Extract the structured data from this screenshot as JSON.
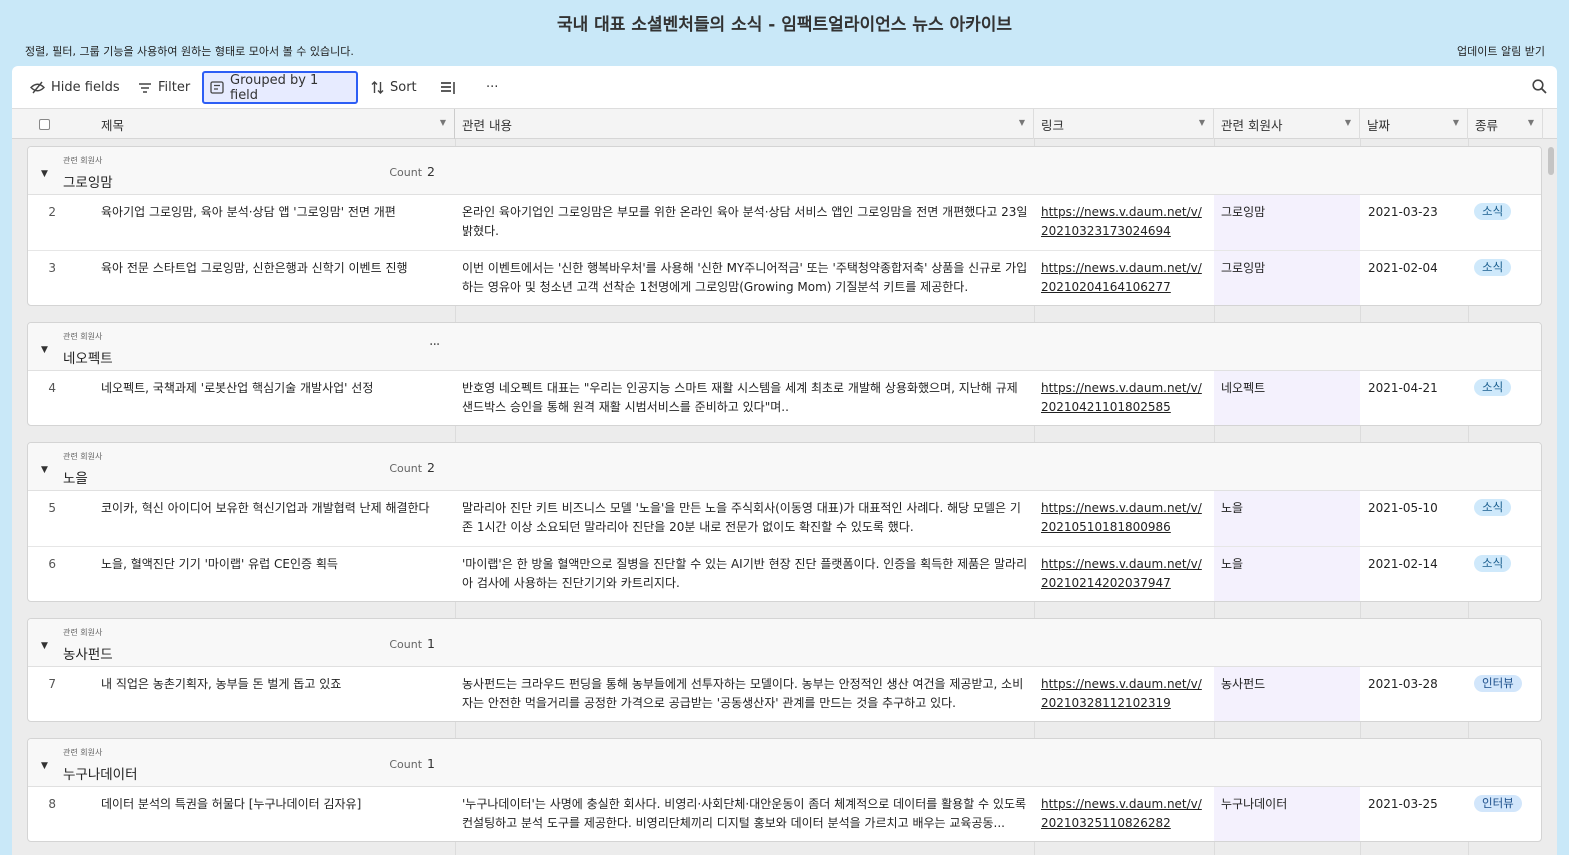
{
  "page": {
    "title": "국내 대표 소셜벤처들의 소식 - 임팩트얼라이언스 뉴스 아카이브",
    "subtitle": "정렬, 필터, 그룹 기능을 사용하여 원하는 형태로 모아서 볼 수 있습니다.",
    "subscribe": "업데이트 알림 받기"
  },
  "toolbar": {
    "hide_fields": "Hide fields",
    "filter": "Filter",
    "grouped": "Grouped by 1 field",
    "sort": "Sort",
    "more": "···"
  },
  "columns": {
    "title": "제목",
    "content": "관련 내용",
    "link": "링크",
    "member": "관련 회원사",
    "date": "날짜",
    "type": "종류"
  },
  "groups": [
    {
      "field": "관련 회원사",
      "name": "그로잉맘",
      "count_label": "Count",
      "count": "2",
      "rows": [
        {
          "num": "2",
          "title": "육아기업 그로잉맘, 육아 분석·상담 앱 '그로잉맘' 전면 개편",
          "content": "온라인 육아기업인 그로잉맘은 부모를 위한 온라인 육아 분석·상담 서비스 앱인 그로잉맘을 전면 개편했다고 23일 밝혔다.",
          "link": "https://news.v.daum.net/v/20210323173024694",
          "member": "그로잉맘",
          "date": "2021-03-23",
          "type": "소식"
        },
        {
          "num": "3",
          "title": "육아 전문 스타트업 그로잉맘, 신한은행과 신학기 이벤트 진행",
          "content": "이번 이벤트에서는 '신한 행복바우처'를 사용해 '신한 MY주니어적금' 또는 '주택청약종합저축' 상품을 신규로 가입하는 영유아 및 청소년 고객 선착순 1천명에게 그로잉맘(Growing Mom) 기질분석 키트를 제공한다.",
          "link": "https://news.v.daum.net/v/20210204164106277",
          "member": "그로잉맘",
          "date": "2021-02-04",
          "type": "소식"
        }
      ]
    },
    {
      "field": "관련 회원사",
      "name": "네오펙트",
      "more": "···",
      "rows": [
        {
          "num": "4",
          "title": "네오펙트, 국책과제 '로봇산업 핵심기술 개발사업' 선정",
          "content": "반호영 네오펙트 대표는 \"우리는 인공지능 스마트 재활 시스템을 세계 최초로 개발해 상용화했으며, 지난해 규제샌드박스 승인을 통해 원격 재활 시범서비스를 준비하고 있다\"며..",
          "link": "https://news.v.daum.net/v/20210421101802585",
          "member": "네오펙트",
          "date": "2021-04-21",
          "type": "소식"
        }
      ]
    },
    {
      "field": "관련 회원사",
      "name": "노을",
      "count_label": "Count",
      "count": "2",
      "rows": [
        {
          "num": "5",
          "title": "코이카, 혁신 아이디어 보유한 혁신기업과 개발협력 난제 해결한다",
          "content": "말라리아 진단 키트 비즈니스 모델 '노을'을 만든 노을 주식회사(이동영 대표)가 대표적인 사례다. 해당 모델은 기존 1시간 이상 소요되던 말라리아 진단을 20분 내로 전문가 없이도 확진할 수 있도록 했다.",
          "link": "https://news.v.daum.net/v/20210510181800986",
          "member": "노을",
          "date": "2021-05-10",
          "type": "소식"
        },
        {
          "num": "6",
          "title": "노을, 혈액진단 기기 '마이랩' 유럽 CE인증 획득",
          "content": "'마이랩'은 한 방울 혈액만으로 질병을 진단할 수 있는 AI기반 현장 진단 플랫폼이다.  인증을 획득한 제품은 말라리아 검사에 사용하는 진단기기와 카트리지다.",
          "link": "https://news.v.daum.net/v/20210214202037947",
          "member": "노을",
          "date": "2021-02-14",
          "type": "소식"
        }
      ]
    },
    {
      "field": "관련 회원사",
      "name": "농사펀드",
      "count_label": "Count",
      "count": "1",
      "rows": [
        {
          "num": "7",
          "title": "내 직업은 농촌기획자, 농부들 돈 벌게 돕고 있죠",
          "content": "농사펀드는 크라우드 펀딩을 통해 농부들에게 선투자하는 모델이다. 농부는 안정적인 생산 여건을 제공받고, 소비자는 안전한 먹을거리를 공정한 가격으로 공급받는 '공동생산자' 관계를 만드는 것을 추구하고 있다.",
          "link": "https://news.v.daum.net/v/20210328112102319",
          "member": "농사펀드",
          "date": "2021-03-28",
          "type": "인터뷰"
        }
      ]
    },
    {
      "field": "관련 회원사",
      "name": "누구나데이터",
      "count_label": "Count",
      "count": "1",
      "rows": [
        {
          "num": "8",
          "title": "데이터 분석의 특권을 허물다 [누구나데이터 김자유]",
          "content": "'누구나데이터'는 사명에 충실한 회사다. 비영리·사회단체·대안운동이 좀더 체계적으로 데이터를 활용할 수 있도록 컨설팅하고 분석 도구를 제공한다. 비영리단체끼리 디지털 홍보와 데이터 분석을 가르치고 배우는 교육공동...",
          "link": "https://news.v.daum.net/v/20210325110826282",
          "member": "누구나데이터",
          "date": "2021-03-25",
          "type": "인터뷰"
        }
      ]
    }
  ]
}
